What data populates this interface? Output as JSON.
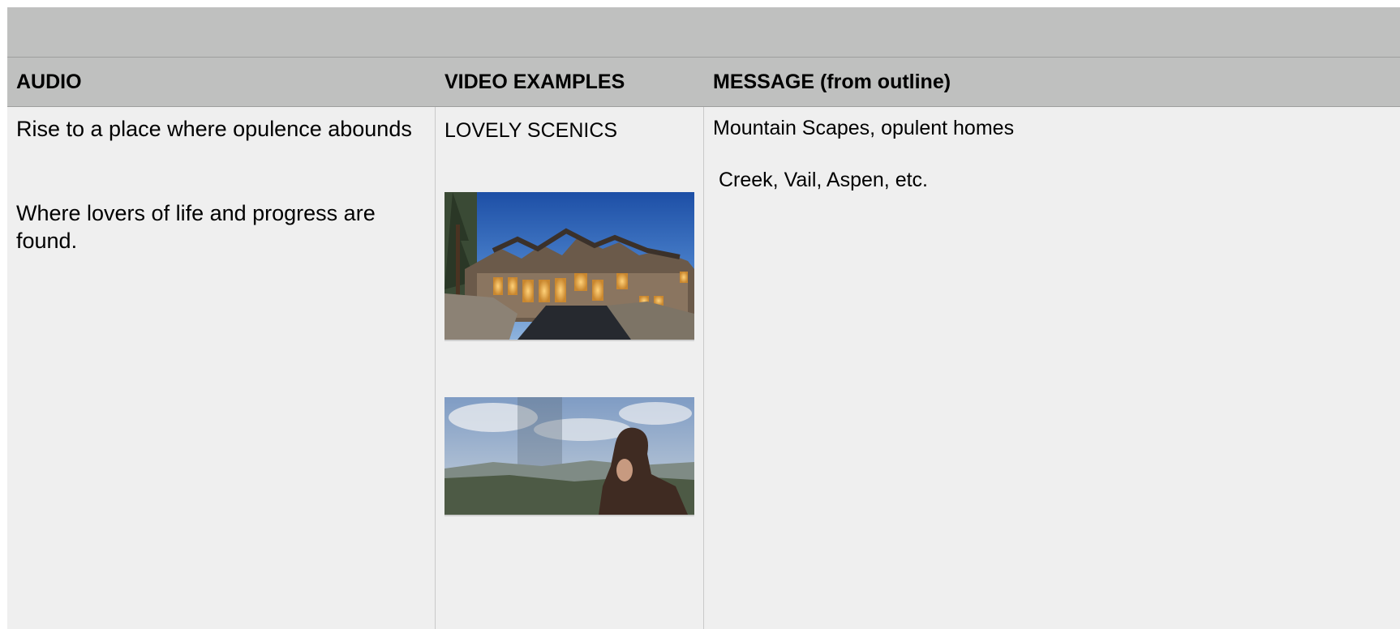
{
  "table": {
    "headers": {
      "audio": "AUDIO",
      "video": "VIDEO EXAMPLES",
      "message": "MESSAGE (from outline)"
    },
    "audio": {
      "line1": "Rise to a place where opulence abounds",
      "line2": "Where lovers of life and progress are found."
    },
    "video": {
      "label": "LOVELY SCENICS",
      "images": [
        {
          "icon": "mountain-house-photo"
        },
        {
          "icon": "mountain-view-woman-photo"
        }
      ]
    },
    "message": {
      "line1": "Mountain Scapes, opulent homes",
      "line2": "Creek, Vail, Aspen, etc."
    }
  }
}
